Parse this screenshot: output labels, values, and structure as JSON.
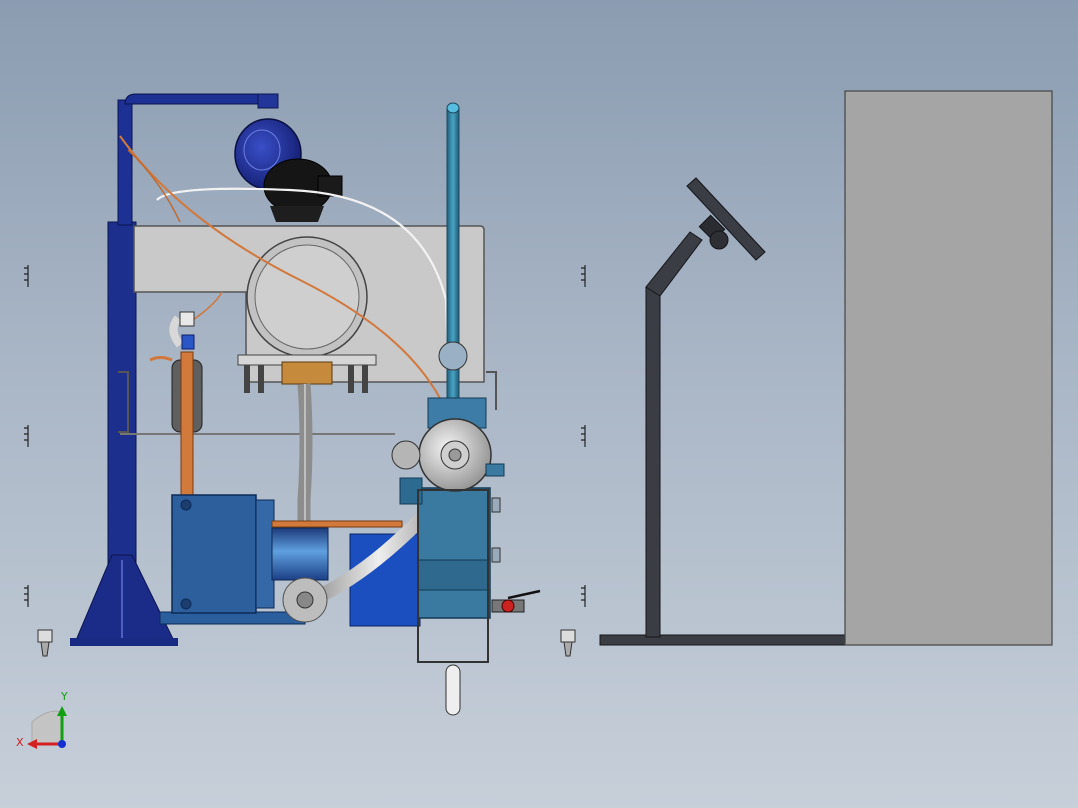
{
  "viewport": {
    "title": ""
  },
  "triad": {
    "x_label": "X",
    "y_label": "Y",
    "x_color": "#d42020",
    "y_color": "#12a012",
    "z_color": "#1530d0"
  },
  "palette": {
    "frame_blue": "#1c2f8c",
    "tank_grey": "#c8c8c8",
    "pump_blue": "#2d5f9c",
    "filter_teal": "#3a7aa0",
    "copper": "#d2783c",
    "panel_grey": "#a5a5a5",
    "stand_dark": "#3a3d44"
  },
  "components": [
    "gantry-column",
    "fan-motor",
    "upper-tank",
    "accumulator",
    "pump-motor",
    "filter-housing",
    "control-panel-stand",
    "cabinet"
  ]
}
